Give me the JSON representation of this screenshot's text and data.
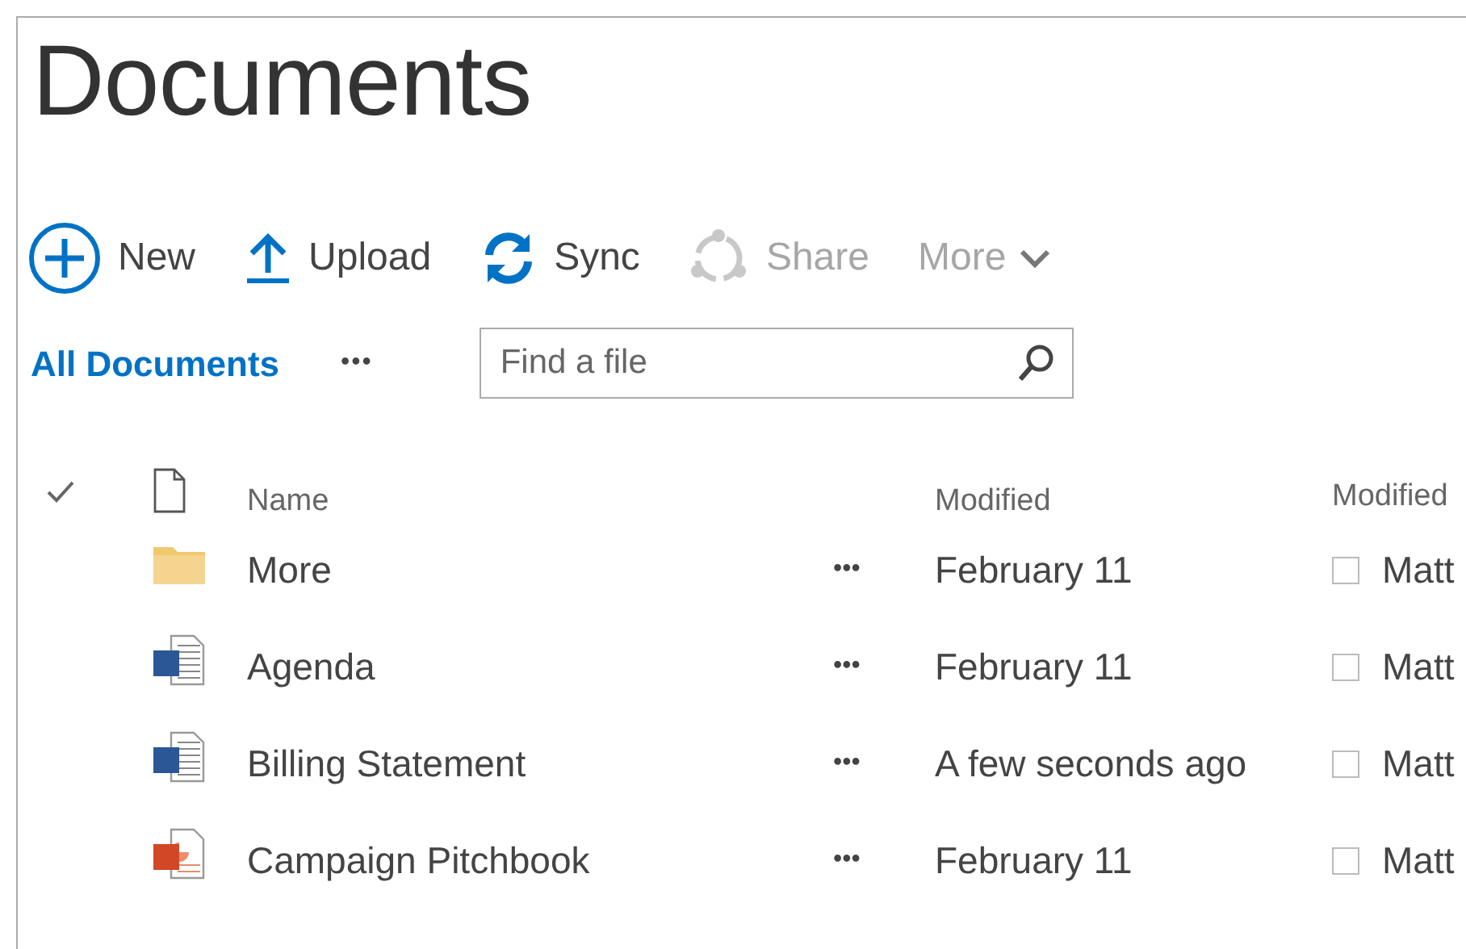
{
  "page": {
    "title": "Documents"
  },
  "toolbar": [
    {
      "kind": "new",
      "label": "New",
      "disabled": false
    },
    {
      "kind": "upload",
      "label": "Upload",
      "disabled": false
    },
    {
      "kind": "sync",
      "label": "Sync",
      "disabled": false
    },
    {
      "kind": "share",
      "label": "Share",
      "disabled": true
    },
    {
      "kind": "more",
      "label": "More",
      "disabled": true
    }
  ],
  "view": {
    "label": "All Documents",
    "menu": "•••"
  },
  "search": {
    "placeholder": "Find a file"
  },
  "table": {
    "columns": [
      "Name",
      "Modified",
      "Modified"
    ],
    "rows": [
      {
        "kind": "folder",
        "name": "More",
        "menu": "•••",
        "modified": "February 11",
        "checked": false,
        "modified_by": "Matt"
      },
      {
        "kind": "word",
        "name": "Agenda",
        "menu": "•••",
        "modified": "February 11",
        "checked": false,
        "modified_by": "Matt"
      },
      {
        "kind": "word",
        "name": "Billing Statement",
        "menu": "•••",
        "modified": "A few seconds ago",
        "checked": false,
        "modified_by": "Matt"
      },
      {
        "kind": "powerpoint",
        "name": "Campaign Pitchbook",
        "menu": "•••",
        "modified": "February 11",
        "checked": false,
        "modified_by": "Matt"
      }
    ]
  }
}
